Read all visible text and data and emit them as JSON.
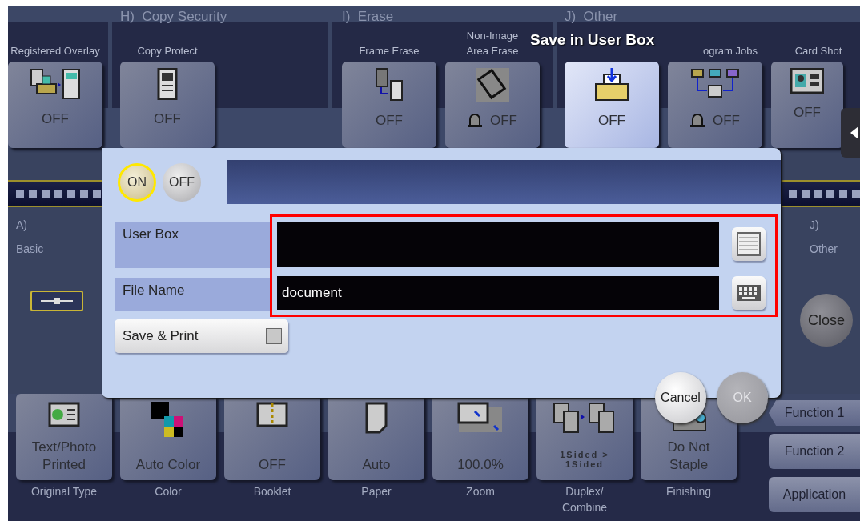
{
  "function_groups": [
    {
      "tiles": [
        {
          "label": "Registered Overlay",
          "value": "OFF",
          "selected": false,
          "memory": false
        }
      ]
    },
    {
      "letter": "H)",
      "title": "Copy Security",
      "tiles": [
        {
          "label": "Copy Protect",
          "value": "OFF",
          "selected": false,
          "memory": false
        }
      ]
    },
    {
      "letter": "I)",
      "title": "Erase",
      "tiles": [
        {
          "label": "Frame Erase",
          "value": "OFF",
          "selected": false,
          "memory": false
        },
        {
          "label": "Non-Image\nArea Erase",
          "value": "OFF",
          "selected": false,
          "memory": true
        }
      ]
    },
    {
      "letter": "J)",
      "title": "Other",
      "tiles": [
        {
          "label": "Save in User Box",
          "value": "OFF",
          "selected": true,
          "memory": false
        },
        {
          "label": "ogram Jobs",
          "value": "OFF",
          "selected": false,
          "memory": true
        },
        {
          "label": "Card Shot",
          "value": "OFF",
          "selected": false,
          "memory": false
        }
      ]
    }
  ],
  "left_panel": {
    "letter": "A)",
    "title": "Basic"
  },
  "right_panel": {
    "letter": "J)",
    "title": "Other"
  },
  "close_button": "Close",
  "dialog": {
    "toggle": [
      {
        "label": "ON",
        "selected": true
      },
      {
        "label": "OFF",
        "selected": false
      }
    ],
    "fields": [
      {
        "label": "User Box",
        "kind": "list"
      },
      {
        "label": "File Name",
        "value": "document",
        "kind": "keyboard"
      }
    ],
    "save_and_print": {
      "label": "Save & Print",
      "checked": false
    },
    "buttons": [
      {
        "label": "Cancel",
        "disabled": false
      },
      {
        "label": "OK",
        "disabled": true
      }
    ]
  },
  "bottom_tiles": [
    {
      "label": "Original Type",
      "value": "Text/Photo\nPrinted"
    },
    {
      "label": "Color",
      "value": "Auto Color"
    },
    {
      "label": "Booklet",
      "value": "OFF"
    },
    {
      "label": "Paper",
      "value": "Auto"
    },
    {
      "label": "Zoom",
      "value": "100.0%"
    },
    {
      "label": "Duplex/\nCombine",
      "value": "1Sided >\n1Sided",
      "kind": "small"
    },
    {
      "label": "Finishing",
      "value": "Do Not\nStaple"
    }
  ],
  "side_buttons": [
    {
      "label": "Function 1",
      "selected": true
    },
    {
      "label": "Function 2",
      "selected": false
    },
    {
      "label": "Application",
      "selected": false
    }
  ]
}
